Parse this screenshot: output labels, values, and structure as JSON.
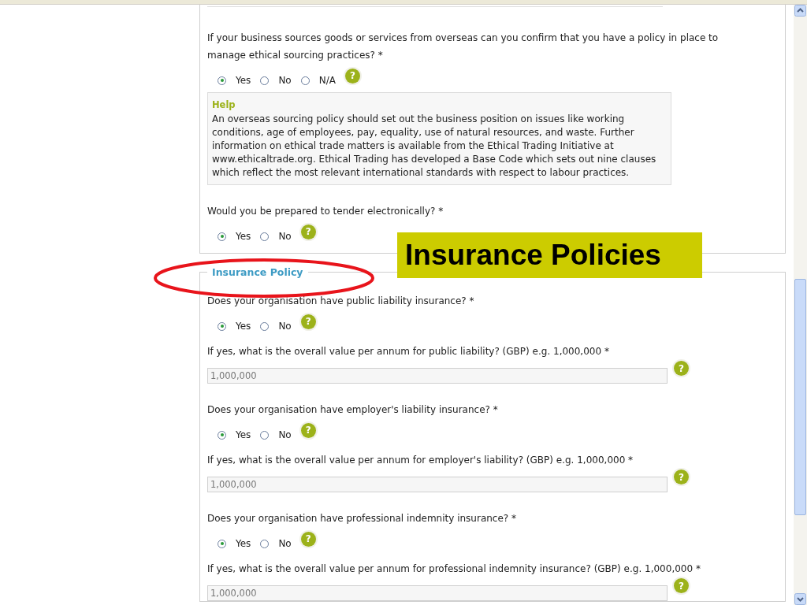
{
  "sections": [
    {
      "items": [
        {
          "kind": "question",
          "text": "If your business sources goods or services from overseas can you confirm that you have a policy in place to manage ethical sourcing practices? *"
        },
        {
          "kind": "radio",
          "help": "?",
          "options": [
            {
              "label": "Yes",
              "selected": true
            },
            {
              "label": "No",
              "selected": false
            },
            {
              "label": "N/A",
              "selected": false
            }
          ]
        },
        {
          "kind": "help_box",
          "title": "Help",
          "text": "An overseas sourcing policy should set out the business position on issues like working conditions, age of employees, pay, equality, use of natural resources, and waste. Further information on ethical trade matters is available from the Ethical Trading Initiative at www.ethicaltrade.org. Ethical Trading has developed a Base Code which sets out nine clauses which reflect the most relevant international standards with respect to labour practices."
        },
        {
          "kind": "question",
          "text": "Would you be prepared to tender electronically? *"
        },
        {
          "kind": "radio",
          "help": "?",
          "options": [
            {
              "label": "Yes",
              "selected": true
            },
            {
              "label": "No",
              "selected": false
            }
          ]
        }
      ]
    },
    {
      "legend": "Insurance Policy",
      "items": [
        {
          "kind": "question",
          "text": "Does your organisation have public liability insurance? *"
        },
        {
          "kind": "radio",
          "help": "?",
          "options": [
            {
              "label": "Yes",
              "selected": true
            },
            {
              "label": "No",
              "selected": false
            }
          ]
        },
        {
          "kind": "question",
          "text": "If yes, what is the overall value per annum for public liability? (GBP) e.g. 1,000,000 *"
        },
        {
          "kind": "input",
          "help": "?",
          "value": "1,000,000"
        },
        {
          "kind": "question",
          "text": "Does your organisation have employer's liability insurance? *"
        },
        {
          "kind": "radio",
          "help": "?",
          "options": [
            {
              "label": "Yes",
              "selected": true
            },
            {
              "label": "No",
              "selected": false
            }
          ]
        },
        {
          "kind": "question",
          "text": "If yes, what is the overall value per annum for employer's liability? (GBP) e.g. 1,000,000 *"
        },
        {
          "kind": "input",
          "help": "?",
          "value": "1,000,000"
        },
        {
          "kind": "question",
          "text": "Does your organisation have professional indemnity insurance? *"
        },
        {
          "kind": "radio",
          "help": "?",
          "options": [
            {
              "label": "Yes",
              "selected": true
            },
            {
              "label": "No",
              "selected": false
            }
          ]
        },
        {
          "kind": "question",
          "text": "If yes, what is the overall value per annum for professional indemnity insurance? (GBP) e.g. 1,000,000 *"
        },
        {
          "kind": "input",
          "help": "?",
          "value": "1,000,000"
        }
      ]
    }
  ],
  "banner": "Insurance Policies"
}
